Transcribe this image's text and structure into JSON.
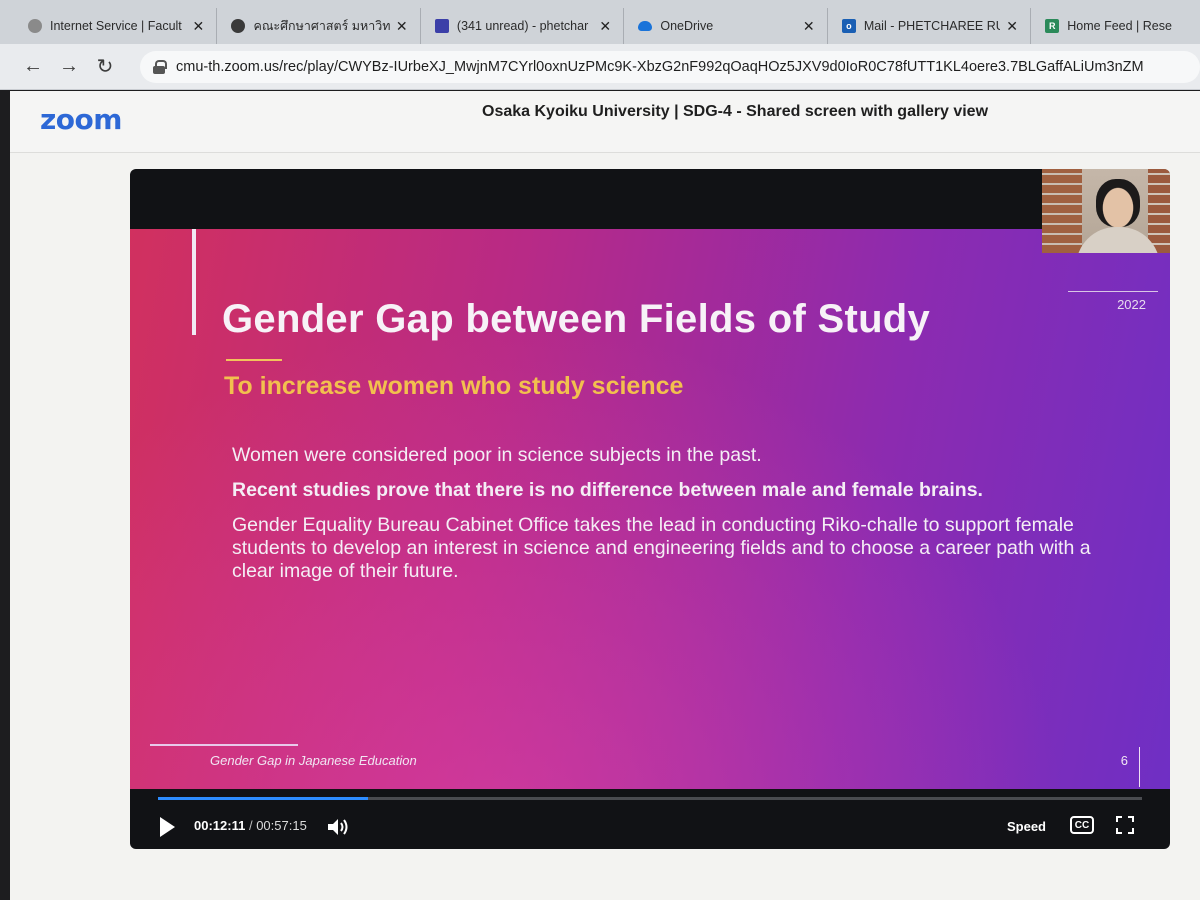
{
  "browser": {
    "tabs": [
      {
        "label": "Internet Service | Facult",
        "icon": "globe-icon",
        "color": "#7a7a7a"
      },
      {
        "label": "คณะศึกษาศาสตร์ มหาวิทยา",
        "icon": "globe-icon",
        "color": "#3a3a3a"
      },
      {
        "label": "(341 unread) - phetchar",
        "icon": "mail-icon",
        "color": "#3b3fa8"
      },
      {
        "label": "OneDrive",
        "icon": "cloud-icon",
        "color": "#1a73d9"
      },
      {
        "label": "Mail - PHETCHAREE RU",
        "icon": "outlook-icon",
        "color": "#1a5fb4"
      },
      {
        "label": "Home Feed | Rese",
        "icon": "researchgate-icon",
        "color": "#2b8a5a"
      }
    ],
    "close_glyph": "✕",
    "url": "cmu-th.zoom.us/rec/play/CWYBz-IUrbeXJ_MwjnM7CYrl0oxnUzPMc9K-XbzG2nF992qOaqHOz5JXV9d0IoR0C78fUTT1KL4oere3.7BLGaffALiUm3nZM"
  },
  "zoom": {
    "logo": "zoom",
    "meeting_title": "Osaka Kyoiku University | SDG-4 - Shared screen with gallery view"
  },
  "slide": {
    "title": "Gender Gap between Fields of Study",
    "subtitle": "To increase women who study science",
    "year": "2022",
    "bullets": [
      "Women were considered poor in science subjects in the past.",
      "Recent studies prove that there is no difference between male and female brains.",
      "Gender Equality Bureau Cabinet Office takes the lead in conducting Riko-challe to support female students to develop an interest in science and engineering fields and to choose a career path with a clear image of their future."
    ],
    "footer": "Gender Gap in Japanese Education",
    "page_number": "6"
  },
  "player": {
    "current_time": "00:12:11",
    "duration": "00:57:15",
    "time_separator": "/",
    "progress_fraction": 0.213,
    "speed_label": "Speed",
    "cc_label": "CC"
  },
  "colors": {
    "zoom_blue": "#2d68d6",
    "subtitle_yellow": "#f2c04e",
    "progress_blue": "#2d8cff"
  }
}
